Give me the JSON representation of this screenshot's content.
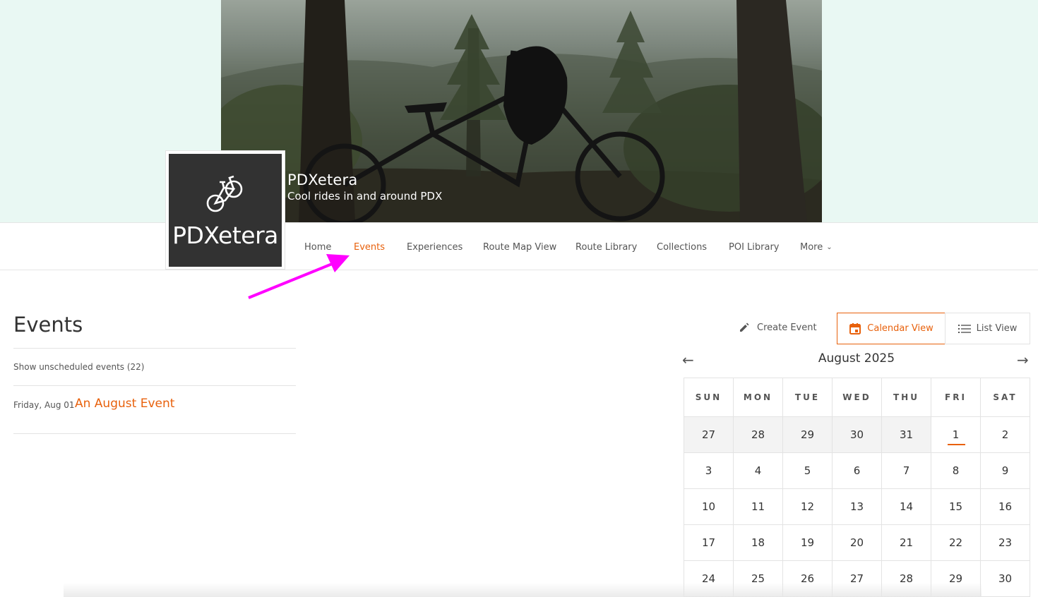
{
  "club": {
    "name": "PDXetera",
    "tagline": "Cool rides in and around PDX",
    "logo_text": "PDXetera"
  },
  "nav": {
    "items": [
      {
        "label": "Home",
        "active": false
      },
      {
        "label": "Events",
        "active": true
      },
      {
        "label": "Experiences",
        "active": false
      },
      {
        "label": "Route Map View",
        "active": false
      },
      {
        "label": "Route Library",
        "active": false
      },
      {
        "label": "Collections",
        "active": false
      },
      {
        "label": "POI Library",
        "active": false
      },
      {
        "label": "More",
        "active": false
      }
    ]
  },
  "events": {
    "title": "Events",
    "unscheduled_label": "Show unscheduled events (22)",
    "list": [
      {
        "date": "Friday, Aug 01",
        "title": "An August Event"
      }
    ]
  },
  "toolbar": {
    "create_event_label": "Create Event",
    "calendar_view_label": "Calendar View",
    "list_view_label": "List View"
  },
  "calendar": {
    "month_label": "August 2025",
    "weekdays": [
      "SUN",
      "MON",
      "TUE",
      "WED",
      "THU",
      "FRI",
      "SAT"
    ],
    "weeks": [
      [
        {
          "d": "27",
          "o": true
        },
        {
          "d": "28",
          "o": true
        },
        {
          "d": "29",
          "o": true
        },
        {
          "d": "30",
          "o": true
        },
        {
          "d": "31",
          "o": true
        },
        {
          "d": "1",
          "e": true
        },
        {
          "d": "2"
        }
      ],
      [
        {
          "d": "3"
        },
        {
          "d": "4"
        },
        {
          "d": "5"
        },
        {
          "d": "6"
        },
        {
          "d": "7"
        },
        {
          "d": "8"
        },
        {
          "d": "9"
        }
      ],
      [
        {
          "d": "10"
        },
        {
          "d": "11"
        },
        {
          "d": "12"
        },
        {
          "d": "13"
        },
        {
          "d": "14"
        },
        {
          "d": "15"
        },
        {
          "d": "16"
        }
      ],
      [
        {
          "d": "17"
        },
        {
          "d": "18"
        },
        {
          "d": "19"
        },
        {
          "d": "20"
        },
        {
          "d": "21"
        },
        {
          "d": "22"
        },
        {
          "d": "23"
        }
      ],
      [
        {
          "d": "24"
        },
        {
          "d": "25"
        },
        {
          "d": "26"
        },
        {
          "d": "27"
        },
        {
          "d": "28"
        },
        {
          "d": "29"
        },
        {
          "d": "30"
        }
      ]
    ]
  },
  "colors": {
    "accent": "#e8610c",
    "hero_background": "#e9f8f3",
    "annotation_arrow": "#ff00ff"
  },
  "icons": {
    "logo": "bicycle-icon",
    "create_event": "pencil-icon",
    "calendar_view": "calendar-icon",
    "list_view": "list-icon",
    "prev": "arrow-left-icon",
    "next": "arrow-right-icon",
    "more": "chevron-down-icon"
  }
}
